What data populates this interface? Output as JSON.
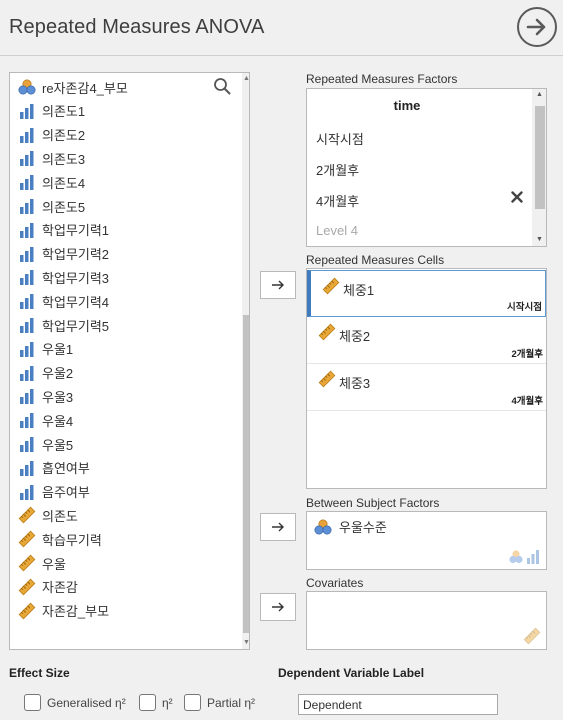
{
  "header": {
    "title": "Repeated Measures ANOVA"
  },
  "variables": [
    {
      "label": "re자존감4_부모",
      "type": "nominal-id"
    },
    {
      "label": "의존도1",
      "type": "ordinal"
    },
    {
      "label": "의존도2",
      "type": "ordinal"
    },
    {
      "label": "의존도3",
      "type": "ordinal"
    },
    {
      "label": "의존도4",
      "type": "ordinal"
    },
    {
      "label": "의존도5",
      "type": "ordinal"
    },
    {
      "label": "학업무기력1",
      "type": "ordinal"
    },
    {
      "label": "학업무기력2",
      "type": "ordinal"
    },
    {
      "label": "학업무기력3",
      "type": "ordinal"
    },
    {
      "label": "학업무기력4",
      "type": "ordinal"
    },
    {
      "label": "학업무기력5",
      "type": "ordinal"
    },
    {
      "label": "우울1",
      "type": "ordinal"
    },
    {
      "label": "우울2",
      "type": "ordinal"
    },
    {
      "label": "우울3",
      "type": "ordinal"
    },
    {
      "label": "우울4",
      "type": "ordinal"
    },
    {
      "label": "우울5",
      "type": "ordinal"
    },
    {
      "label": "흡연여부",
      "type": "ordinal"
    },
    {
      "label": "음주여부",
      "type": "ordinal"
    },
    {
      "label": "의존도",
      "type": "continuous"
    },
    {
      "label": "학습무기력",
      "type": "continuous"
    },
    {
      "label": "우울",
      "type": "continuous"
    },
    {
      "label": "자존감",
      "type": "continuous"
    },
    {
      "label": "자존감_부모",
      "type": "continuous"
    }
  ],
  "rm_factors": {
    "label": "Repeated Measures Factors",
    "factor_name": "time",
    "levels": [
      "시작시점",
      "2개월후",
      "4개월후"
    ],
    "placeholder": "Level 4"
  },
  "rm_cells": {
    "label": "Repeated Measures Cells",
    "cells": [
      {
        "name": "체중1",
        "level": "시작시점"
      },
      {
        "name": "체중2",
        "level": "2개월후"
      },
      {
        "name": "체중3",
        "level": "4개월후"
      }
    ]
  },
  "between": {
    "label": "Between Subject Factors",
    "items": [
      "우울수준"
    ]
  },
  "covariates": {
    "label": "Covariates"
  },
  "effect_size": {
    "heading": "Effect Size",
    "options": [
      "Generalised η²",
      "η²",
      "Partial η²"
    ]
  },
  "dv_label": {
    "heading": "Dependent Variable Label",
    "value": "Dependent"
  },
  "colors": {
    "ordinal": "#4a7fc1",
    "continuous": "#e8a736",
    "nominal_blue": "#5c8fd6",
    "nominal_orange": "#e9a23a"
  }
}
